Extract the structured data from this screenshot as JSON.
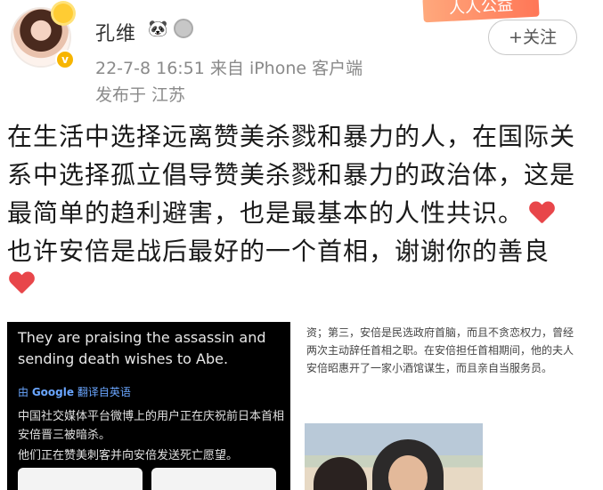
{
  "header": {
    "username": "孔维",
    "panda_emoji": "🐼",
    "meta": "22-7-8 16:51  来自 iPhone 客户端",
    "location": "发布于 江苏",
    "banner_text": "人人公益",
    "follow_label": "+关注"
  },
  "post": {
    "text": "在生活中选择远离赞美杀戮和暴力的人，在国际关系中选择孤立倡导赞美杀戮和暴力的政治体，这是最简单的趋利避害，也是最基本的人性共识。",
    "text2": "也许安倍是战后最好的一个首相，谢谢你的善良"
  },
  "images": {
    "left": {
      "tweet_en": "They are praising the assassin and sending death wishes to Abe.",
      "google_prefix": "由 ",
      "google_brand": "Google",
      "google_suffix": " 翻译自英语",
      "tweet_zh_1": "中国社交媒体平台微博上的用户正在庆祝前日本首相安倍晋三被暗杀。",
      "tweet_zh_2": "他们正在赞美刺客并向安倍发送死亡愿望。"
    },
    "right": {
      "article": "资；第三，安倍是民选政府首脑，而且不贪恋权力，曾经两次主动辞任首相之职。在安倍担任首相期间，他的夫人安倍昭惠开了一家小酒馆谋生，而且亲自当服务员。"
    }
  },
  "colors": {
    "heart": "#e8464a",
    "badge": "#f7b500",
    "meta": "#8a8a8a"
  }
}
